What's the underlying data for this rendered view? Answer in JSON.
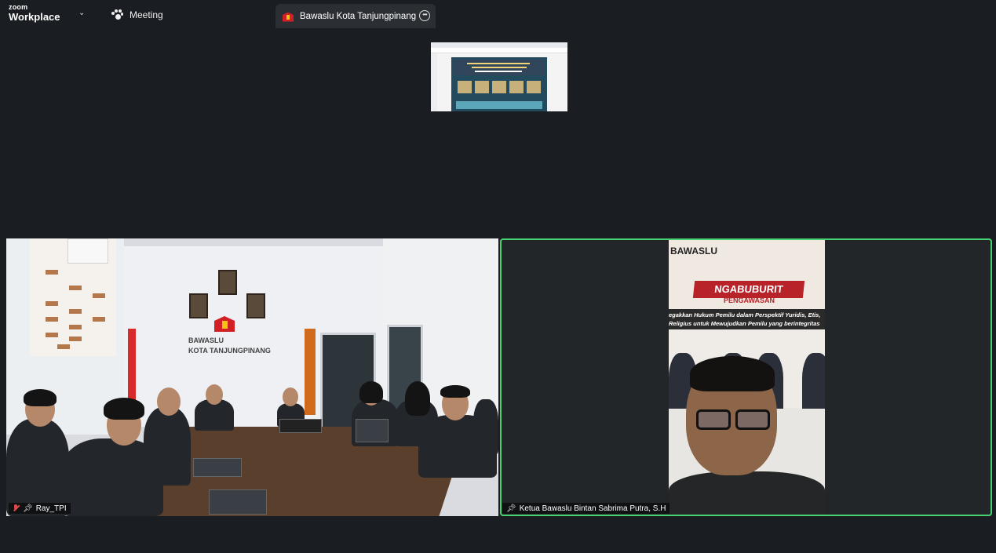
{
  "app": {
    "brand_small": "zoom",
    "brand_big": "Workplace",
    "meeting_label": "Meeting"
  },
  "tab": {
    "title": "Bawaslu Kota Tanjungpinang's sc"
  },
  "participants": [
    {
      "name": "Ray_TPI",
      "muted": true,
      "pinned": true
    },
    {
      "name": "Ketua Bawaslu Bintan Sabrima Putra, S.H",
      "muted": false,
      "pinned": true,
      "active_speaker": true
    }
  ],
  "left_video": {
    "wall_line1": "BAWASLU",
    "wall_line2": "KOTA TANJUNGPINANG"
  },
  "right_video": {
    "poster_brand": "BAWASLU",
    "poster_title": "NGABUBURIT",
    "poster_title2": "PENGAWASAN",
    "poster_line1": "egakkan Hukum Pemilu dalam Perspektif Yuridis, Etis,",
    "poster_line2": "Religius untuk Mewujudkan Pemilu yang berintegritas"
  },
  "colors": {
    "background": "#1a1d21",
    "active_speaker_border": "#46d36f",
    "tab_bg": "#2b2f34"
  },
  "icons": [
    "chevron-down-icon",
    "paw-meeting-icon",
    "bawaslu-logo-icon",
    "more-options-icon",
    "mic-muted-icon",
    "pin-icon"
  ]
}
